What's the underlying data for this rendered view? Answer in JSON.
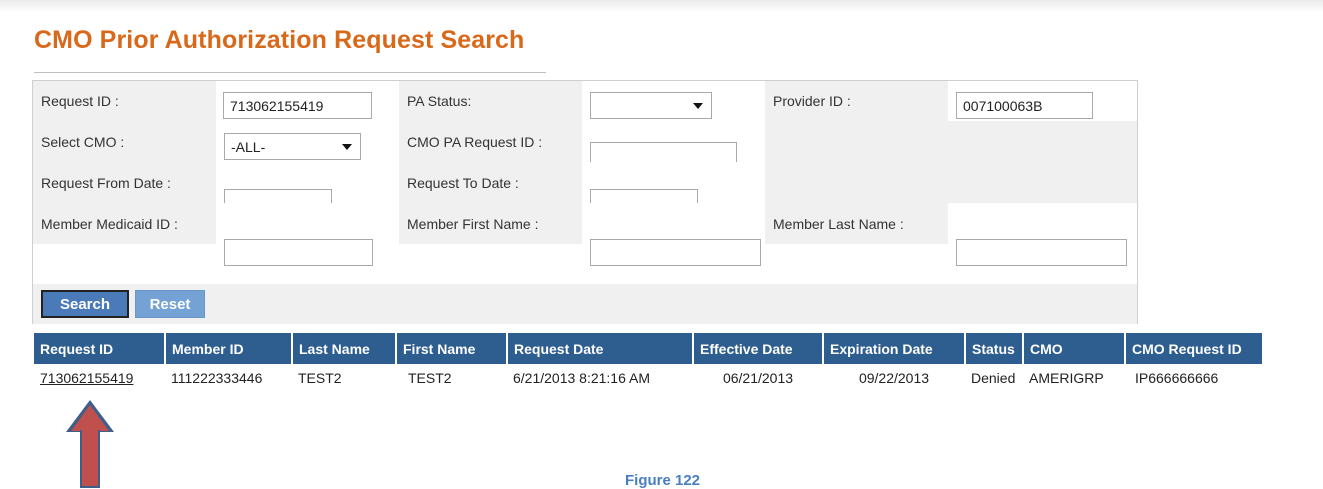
{
  "page": {
    "title": "CMO Prior Authorization Request Search"
  },
  "form": {
    "request_id_label": "Request ID :",
    "request_id_value": "713062155419",
    "pa_status_label": "PA Status:",
    "pa_status_value": "",
    "provider_id_label": "Provider ID :",
    "provider_id_value": "007100063B",
    "select_cmo_label": "Select CMO :",
    "select_cmo_value": "-ALL-",
    "cmo_pa_request_id_label": "CMO PA Request ID :",
    "cmo_pa_request_id_value": "",
    "request_from_date_label": "Request From Date :",
    "request_from_date_value": "",
    "request_to_date_label": "Request To Date :",
    "request_to_date_value": "",
    "member_medicaid_id_label": "Member Medicaid ID :",
    "member_medicaid_id_value": "",
    "member_first_name_label": "Member First Name :",
    "member_first_name_value": "",
    "member_last_name_label": "Member Last Name :",
    "member_last_name_value": "",
    "search_button": "Search",
    "reset_button": "Reset"
  },
  "results": {
    "columns": [
      "Request ID",
      "Member ID",
      "Last Name",
      "First Name",
      "Request Date",
      "Effective Date",
      "Expiration Date",
      "Status",
      "CMO",
      "CMO Request ID"
    ],
    "rows": [
      {
        "request_id": "713062155419",
        "member_id": "111222333446",
        "last_name": "TEST2",
        "first_name": "TEST2",
        "request_date": "6/21/2013 8:21:16 AM",
        "effective_date": "06/21/2013",
        "expiration_date": "09/22/2013",
        "status": "Denied",
        "cmo": "AMERIGRP",
        "cmo_request_id": "IP666666666"
      }
    ]
  },
  "caption": "Figure 122",
  "colors": {
    "title": "#d9691a",
    "header_bg": "#2e5d8f",
    "button": "#4a7ab7",
    "arrow": "#c0504d"
  }
}
